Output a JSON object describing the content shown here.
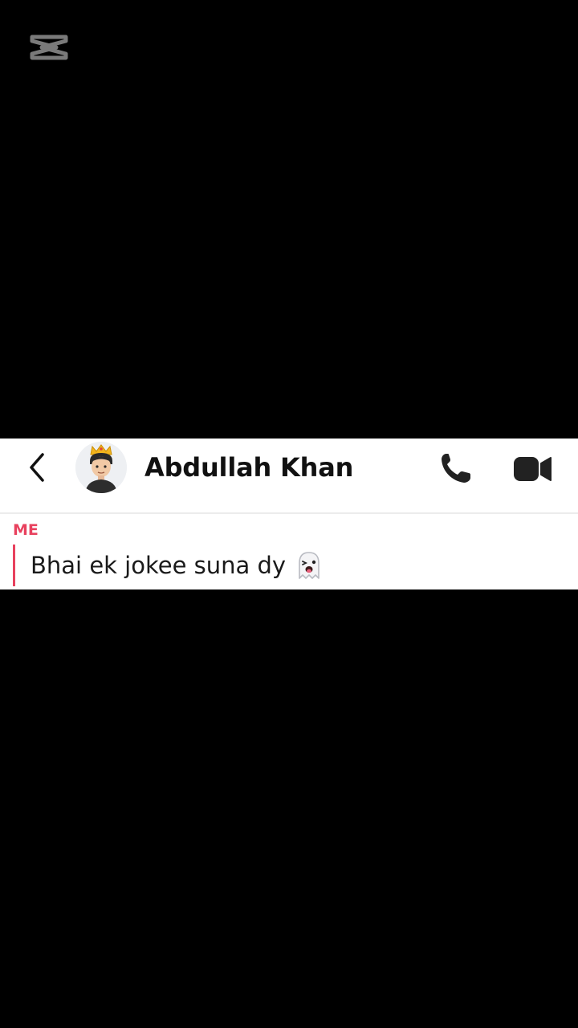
{
  "icons": {
    "watermark": "capcut-logo-icon",
    "back": "chevron-left-icon",
    "call": "phone-icon",
    "video": "video-camera-icon",
    "emoji": "ghost-emoji-icon"
  },
  "colors": {
    "background": "#000000",
    "panel": "#ffffff",
    "sender_accent": "#e8415e",
    "icon_dark": "#222222"
  },
  "header": {
    "contact_name": "Abdullah Khan"
  },
  "conversation": {
    "messages": [
      {
        "sender": "ME",
        "text": "Bhai ek jokee suna dy"
      }
    ]
  }
}
